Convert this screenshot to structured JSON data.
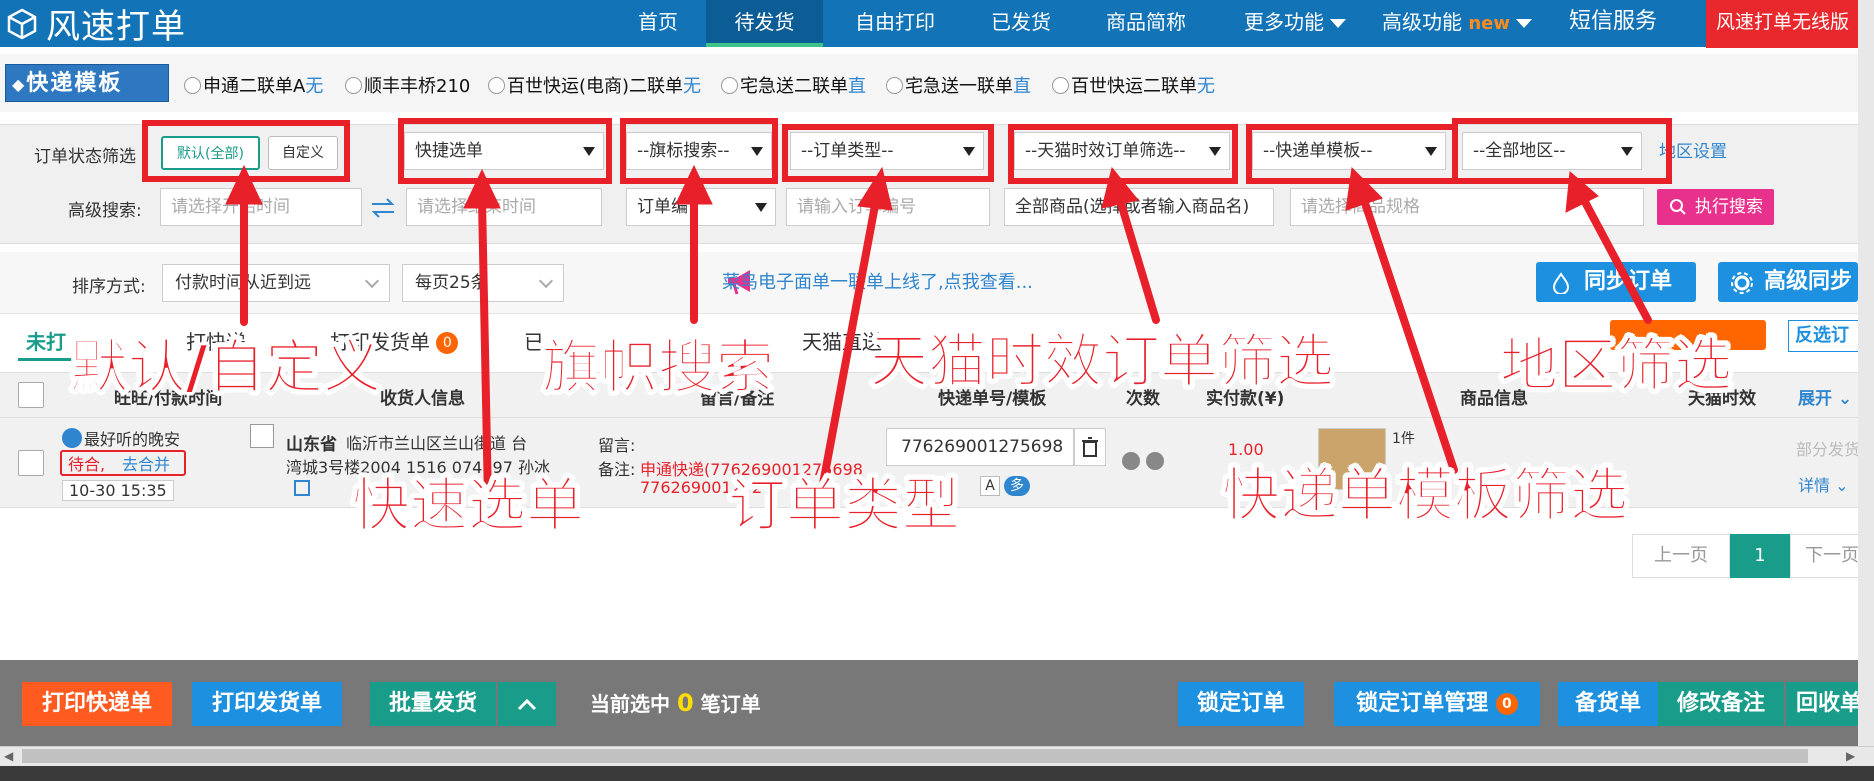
{
  "nav": {
    "brand": "风速打单",
    "items": [
      "首页",
      "待发货",
      "自由打印",
      "已发货",
      "商品简称"
    ],
    "more": "更多功能",
    "advanced": "高级功能",
    "advanced_new": "new",
    "sms": "短信服务",
    "wireless": "风速打单无线版"
  },
  "templates": {
    "title": "快递模板",
    "options": [
      {
        "name": "申通二联单A",
        "tag": "无"
      },
      {
        "name": "顺丰丰桥210",
        "tag": ""
      },
      {
        "name": "百世快运(电商)二联单",
        "tag": "无"
      },
      {
        "name": "宅急送二联单",
        "tag": "直"
      },
      {
        "name": "宅急送一联单",
        "tag": "直"
      },
      {
        "name": "百世快运二联单",
        "tag": "无"
      }
    ]
  },
  "filter": {
    "status_label": "订单状态筛选",
    "default_btn": "默认(全部)",
    "custom_btn": "自定义",
    "quick_select": "快捷选单",
    "flag_search": "--旗标搜索--",
    "order_type": "--订单类型--",
    "tmall_filter": "--天猫时效订单筛选--",
    "waybill_tpl": "--快递单模板--",
    "region": "--全部地区--",
    "region_link": "地区设置",
    "adv_label": "高级搜索:",
    "start_time_ph": "请选择开始时间",
    "end_time_ph": "请选择结束时间",
    "order_field": "订单编",
    "order_no_ph": "请输入订单编号",
    "goods_ph": "全部商品(选择或者输入商品名)",
    "spec_ph": "请选择商品规格",
    "exec_btn": "执行搜索"
  },
  "sort": {
    "label": "排序方式:",
    "order": "付款时间从近到远",
    "page_size": "每页25条",
    "notice": "菜鸟电子面单一联单上线了,点我查看...",
    "sync_btn": "同步订单",
    "adv_sync_btn": "高级同步"
  },
  "tabs": {
    "items": [
      "未打",
      "打快递",
      "打印发货单",
      "已",
      "天猫直送"
    ],
    "badge": "0",
    "reverse": "反选订"
  },
  "table": {
    "headers": [
      "旺旺/付款时间",
      "收货人信息",
      "留言/备注",
      "快递单号/模板",
      "次数",
      "实付款(¥)",
      "商品信息",
      "天猫时效"
    ],
    "expand": "展开",
    "row": {
      "buyer": "最好听的晚安",
      "wait": "待合,",
      "merge": "去合并",
      "time": "10-30 15:35",
      "province": "山东省",
      "address": "临沂市兰山区兰山街道 台",
      "address2": "湾城3号楼2004 1516 074297 孙冰",
      "msg_label": "留言:",
      "note_label": "备注:",
      "note_text": "申通快递(776269001275698",
      "note_text2": "776269001272",
      "waybill": "776269001275698",
      "amount": "1.00",
      "qty": "1件",
      "part": "部分发货",
      "detail": "详情",
      "tag_a": "A",
      "tag_duo": "多"
    }
  },
  "pagination": {
    "prev": "上一页",
    "current": "1",
    "next": "下一页"
  },
  "bottom": {
    "print_express": "打印快递单",
    "print_ship": "打印发货单",
    "batch_ship": "批量发货",
    "selected_prefix": "当前选中",
    "selected_count": "0",
    "selected_suffix": "笔订单",
    "lock": "锁定订单",
    "lock_manage": "锁定订单管理",
    "lock_badge": "0",
    "stock": "备货单",
    "edit_note": "修改备注",
    "recycle": "回收单"
  },
  "annotations": {
    "default_custom": "默认/自定义",
    "flag": "旗帜搜索",
    "tmall": "天猫时效订单筛选",
    "region": "地区筛选",
    "quick": "快速选单",
    "type": "订单类型",
    "tpl": "快递单模板筛选"
  },
  "colors": {
    "nav": "#1273b7",
    "accent_red": "#e8202a",
    "teal": "#1a9c8a",
    "pink": "#e8308d",
    "blue_btn": "#1e90e0"
  }
}
